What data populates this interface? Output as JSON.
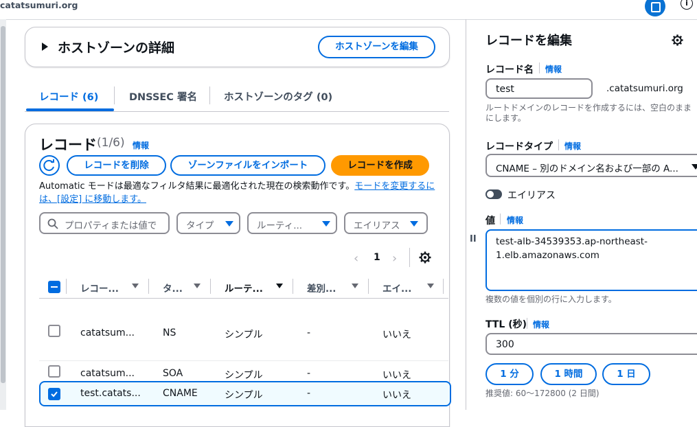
{
  "browser": {
    "domain": "catatsumuri.org"
  },
  "hosted_zone": {
    "details_title": "ホストゾーンの詳細",
    "edit_button": "ホストゾーンを編集"
  },
  "tabs": [
    {
      "label": "レコード (6)",
      "active": true
    },
    {
      "label": "DNSSEC 署名",
      "active": false
    },
    {
      "label": "ホストゾーンのタグ (0)",
      "active": false
    }
  ],
  "records": {
    "title": "レコード",
    "count": "(1/6)",
    "info": "情報",
    "delete_button": "レコードを削除",
    "import_button": "ゾーンファイルをインポート",
    "create_button": "レコードを作成",
    "note_text": "Automatic モードは最適なフィルタ結果に最適化された現在の検索動作です。",
    "note_link": "モードを変更するには、[設定] に移動します。",
    "search_placeholder": "プロパティまたは値で",
    "filters": {
      "type": "タイプ",
      "routing": "ルーティ...",
      "alias": "エイリアス"
    },
    "page": "1",
    "columns": [
      "レコー...",
      "タ...",
      "ルーテ...",
      "差別...",
      "エイ..."
    ],
    "rows": [
      {
        "name": "catatsum...",
        "type": "NS",
        "routing": "シンプル",
        "diff": "-",
        "alias": "いいえ",
        "checked": false
      },
      {
        "name": "catatsum...",
        "type": "SOA",
        "routing": "シンプル",
        "diff": "-",
        "alias": "いいえ",
        "checked": false
      },
      {
        "name": "test.catats...",
        "type": "CNAME",
        "routing": "シンプル",
        "diff": "-",
        "alias": "いいえ",
        "checked": true
      }
    ]
  },
  "edit_panel": {
    "title": "レコードを編集",
    "record_name_label": "レコード名",
    "info": "情報",
    "record_name_value": "test",
    "domain_suffix": ".catatsumuri.org",
    "record_name_hint": "ルートドメインのレコードを作成するには、空白のままにします。",
    "record_type_label": "レコードタイプ",
    "record_type_value": "CNAME – 別のドメイン名および一部の A...",
    "alias_toggle_label": "エイリアス",
    "value_label": "値",
    "value_text": "test-alb-34539353.ap-northeast-1.elb.amazonaws.com",
    "value_hint": "複数の値を個別の行に入力します。",
    "ttl_label": "TTL (秒)",
    "ttl_value": "300",
    "ttl_presets": [
      "1 分",
      "1 時間",
      "1 日"
    ],
    "ttl_recommend": "推奨値: 60～172800 (2 日間)"
  },
  "colors": {
    "accent": "#006ce0",
    "create": "#ff9900",
    "selected_row": "#f0fbff"
  }
}
